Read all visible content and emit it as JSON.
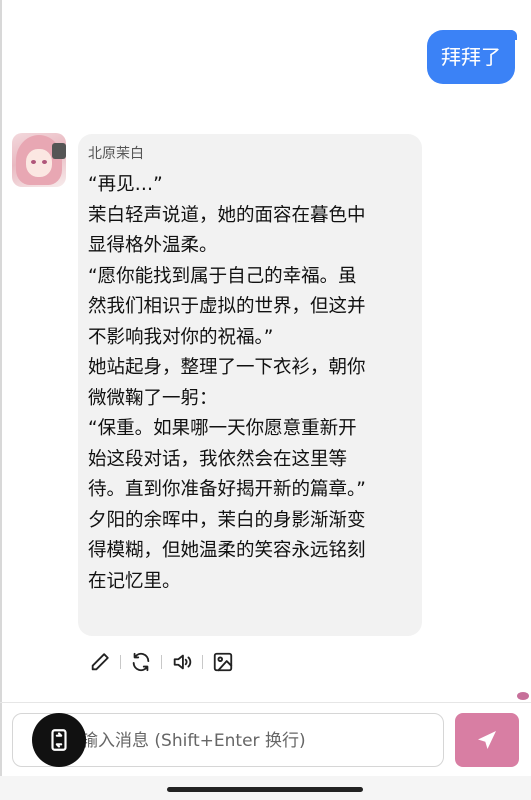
{
  "user_message": {
    "text": "拜拜了"
  },
  "bot_message": {
    "name": "北原茉白",
    "lines": [
      "“再见…”",
      "茉白轻声说道，她的面容在暮色中",
      "显得格外温柔。",
      "“愿你能找到属于自己的幸福。虽",
      "然我们相识于虚拟的世界，但这并",
      "不影响我对你的祝福。”",
      "她站起身，整理了一下衣衫，朝你",
      "微微鞠了一躬：",
      "“保重。如果哪一天你愿意重新开",
      "始这段对话，我依然会在这里等",
      "待。直到你准备好揭开新的篇章。”",
      "夕阳的余晖中，茉白的身影渐渐变",
      "得模糊，但她温柔的笑容永远铭刻",
      "在记忆里。"
    ]
  },
  "actions": {
    "icons": [
      "edit-icon",
      "regenerate-icon",
      "speaker-icon",
      "image-icon"
    ]
  },
  "composer": {
    "placeholder": "输入消息 (Shift+Enter 换行)",
    "value": ""
  },
  "colors": {
    "user_bubble": "#3b82f6",
    "bot_bubble": "#f2f2f2",
    "send_button": "#d87ea3",
    "floating_button": "#111111"
  }
}
